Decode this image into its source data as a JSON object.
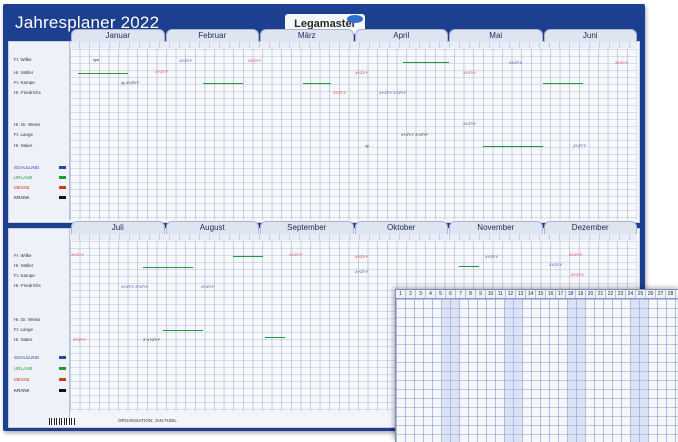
{
  "title": "Jahresplaner 2022",
  "brand": "Legamaster",
  "colors": {
    "board": "#1d3f8f",
    "weekend": "#c6cee4"
  },
  "months_top": [
    "Januar",
    "Februar",
    "März",
    "April",
    "Mai",
    "Juni"
  ],
  "months_bottom": [
    "Juli",
    "August",
    "September",
    "Oktober",
    "November",
    "Dezember"
  ],
  "names_top": [
    "Fr. Wilke",
    "Hr. Müller",
    "Fr. Kampe",
    "Hr. Friedrichs",
    "Hr. Dr. Weiss",
    "Fr. Lange",
    "Hr. Maier"
  ],
  "names_bottom": [
    "Fr. Wilke",
    "Hr. Müller",
    "Fr. Kampe",
    "Hr. Friedrichs",
    "Hr. Dr. Weiss",
    "Fr. Lange",
    "Hr. Maier"
  ],
  "legend_top": [
    {
      "label": "SCHULUNG",
      "color": "#2c45b0"
    },
    {
      "label": "URLAUB",
      "color": "#1e9a3a"
    },
    {
      "label": "MESSE",
      "color": "#d8362a"
    },
    {
      "label": "KRANK",
      "color": "#111111"
    }
  ],
  "legend_bottom": [
    {
      "label": "SCHULUNG",
      "color": "#2c45b0"
    },
    {
      "label": "URLAUB",
      "color": "#1e9a3a"
    },
    {
      "label": "MESSE",
      "color": "#d8362a"
    },
    {
      "label": "KRANK",
      "color": "#111111"
    }
  ],
  "organisation": "ORGANISATION: JAN FISEL",
  "inset_days": [
    "1",
    "2",
    "3",
    "4",
    "5",
    "6",
    "7",
    "8",
    "9",
    "10",
    "11",
    "12",
    "13",
    "14",
    "15",
    "16",
    "17",
    "18",
    "19",
    "20",
    "21",
    "22",
    "23",
    "24",
    "25",
    "26",
    "27",
    "28",
    "29",
    "30",
    "31"
  ]
}
